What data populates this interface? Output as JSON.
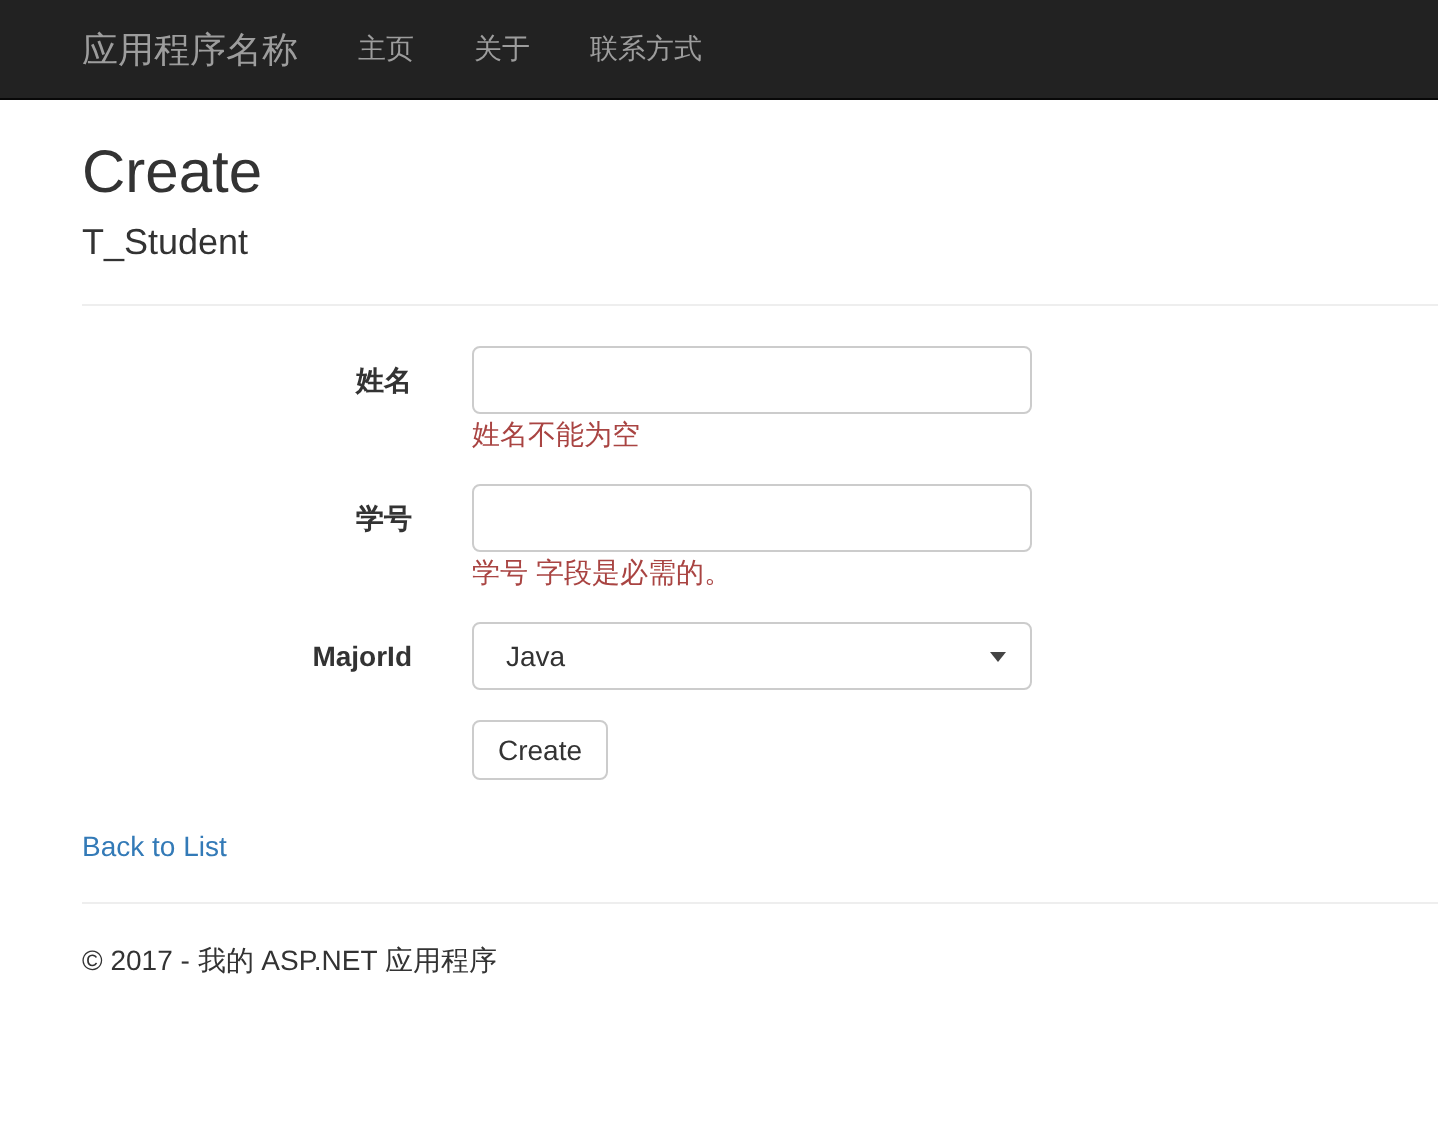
{
  "navbar": {
    "brand": "应用程序名称",
    "links": [
      "主页",
      "关于",
      "联系方式"
    ]
  },
  "heading": "Create",
  "subheading": "T_Student",
  "fields": [
    {
      "kind": "text",
      "label": "姓名",
      "error": "姓名不能为空"
    },
    {
      "kind": "text",
      "label": "学号",
      "error": "学号 字段是必需的。"
    },
    {
      "kind": "select",
      "label": "MajorId",
      "value": "Java"
    }
  ],
  "submit": "Create",
  "back_link": "Back to List",
  "footer": "© 2017 - 我的 ASP.NET 应用程序"
}
